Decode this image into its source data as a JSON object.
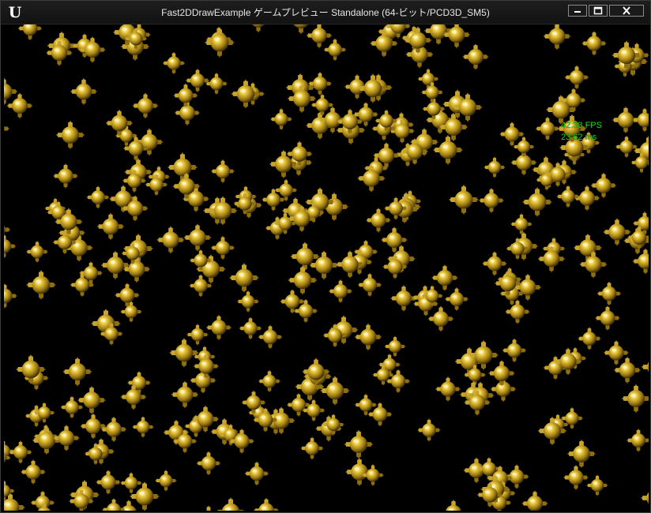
{
  "window": {
    "title": "Fast2DDrawExample ゲームプレビュー Standalone (64-ビット/PCD3D_SM5)",
    "logo_icon": "unreal-engine-logo-icon",
    "controls": {
      "minimize_icon": "minimize-icon",
      "maximize_icon": "maximize-icon",
      "close_icon": "close-icon"
    }
  },
  "stats": {
    "fps": "42.33 FPS",
    "ms": "23.62 ms",
    "color": "#1fd61f"
  },
  "scene": {
    "sprite_icon": "gold-spiked-ball-icon",
    "sprite_color": "#c8a21c",
    "background": "#000000"
  }
}
